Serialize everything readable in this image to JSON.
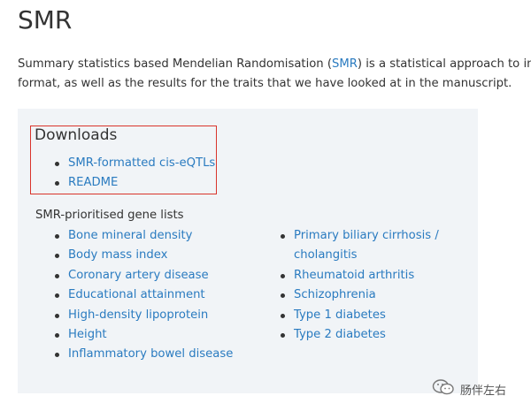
{
  "page": {
    "title": "SMR",
    "intro": {
      "text_before": "Summary statistics based Mendelian Randomisation (",
      "link": "SMR",
      "text_after": ") is a statistical approach to infer pu",
      "line2": "format, as well as the results for the traits that we have looked at in the manuscript."
    }
  },
  "downloads": {
    "heading": "Downloads",
    "items": [
      {
        "label": "SMR-formatted cis-eQTLs"
      },
      {
        "label": "README"
      }
    ]
  },
  "gene_lists": {
    "heading": "SMR-prioritised gene lists",
    "left": [
      {
        "label": "Bone mineral density"
      },
      {
        "label": "Body mass index"
      },
      {
        "label": "Coronary artery disease"
      },
      {
        "label": "Educational attainment"
      },
      {
        "label": "High-density lipoprotein"
      },
      {
        "label": "Height"
      },
      {
        "label": "Inflammatory bowel disease"
      }
    ],
    "right": [
      {
        "label": "Primary biliary cirrhosis / cholangitis"
      },
      {
        "label": "Rheumatoid arthritis"
      },
      {
        "label": "Schizophrenia"
      },
      {
        "label": "Type 1 diabetes"
      },
      {
        "label": "Type 2 diabetes"
      }
    ]
  },
  "watermark": {
    "text": "肠伴左右",
    "icon": "wechat-icon"
  },
  "colors": {
    "link": "#2a7bc0",
    "panel_bg": "#f1f4f7",
    "highlight_border": "#d9342b"
  }
}
